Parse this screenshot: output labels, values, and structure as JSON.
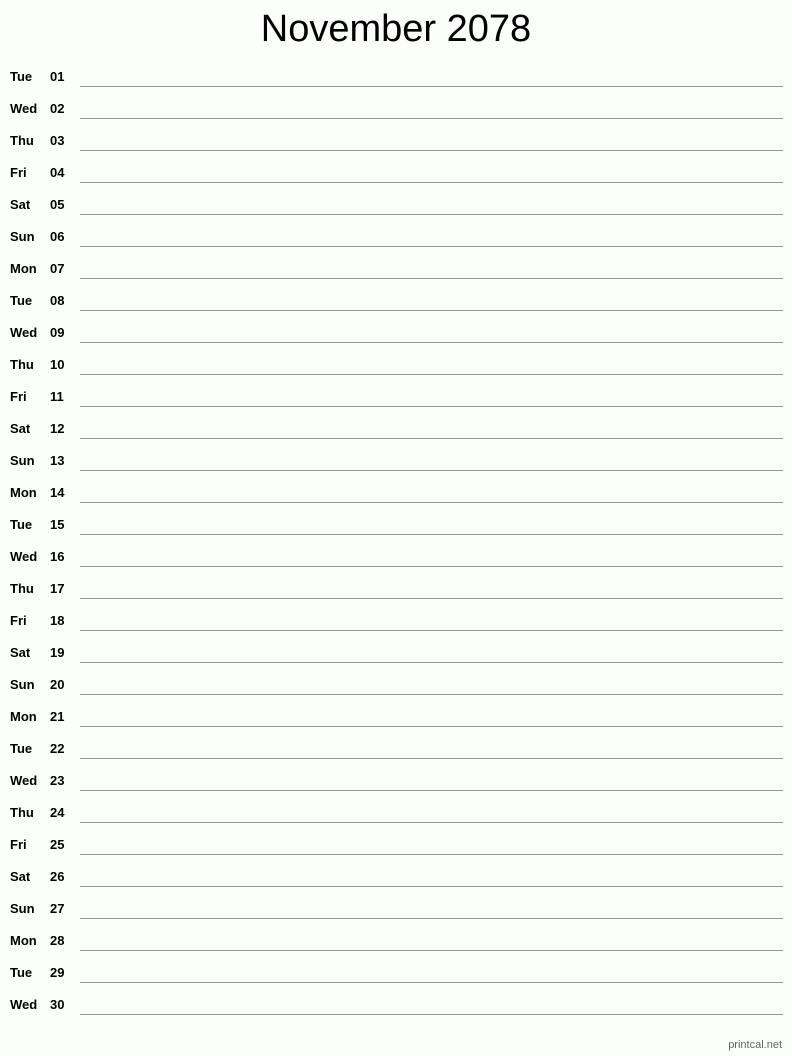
{
  "title": "November 2078",
  "footer": "printcal.net",
  "days": [
    {
      "dow": "Tue",
      "num": "01"
    },
    {
      "dow": "Wed",
      "num": "02"
    },
    {
      "dow": "Thu",
      "num": "03"
    },
    {
      "dow": "Fri",
      "num": "04"
    },
    {
      "dow": "Sat",
      "num": "05"
    },
    {
      "dow": "Sun",
      "num": "06"
    },
    {
      "dow": "Mon",
      "num": "07"
    },
    {
      "dow": "Tue",
      "num": "08"
    },
    {
      "dow": "Wed",
      "num": "09"
    },
    {
      "dow": "Thu",
      "num": "10"
    },
    {
      "dow": "Fri",
      "num": "11"
    },
    {
      "dow": "Sat",
      "num": "12"
    },
    {
      "dow": "Sun",
      "num": "13"
    },
    {
      "dow": "Mon",
      "num": "14"
    },
    {
      "dow": "Tue",
      "num": "15"
    },
    {
      "dow": "Wed",
      "num": "16"
    },
    {
      "dow": "Thu",
      "num": "17"
    },
    {
      "dow": "Fri",
      "num": "18"
    },
    {
      "dow": "Sat",
      "num": "19"
    },
    {
      "dow": "Sun",
      "num": "20"
    },
    {
      "dow": "Mon",
      "num": "21"
    },
    {
      "dow": "Tue",
      "num": "22"
    },
    {
      "dow": "Wed",
      "num": "23"
    },
    {
      "dow": "Thu",
      "num": "24"
    },
    {
      "dow": "Fri",
      "num": "25"
    },
    {
      "dow": "Sat",
      "num": "26"
    },
    {
      "dow": "Sun",
      "num": "27"
    },
    {
      "dow": "Mon",
      "num": "28"
    },
    {
      "dow": "Tue",
      "num": "29"
    },
    {
      "dow": "Wed",
      "num": "30"
    }
  ]
}
